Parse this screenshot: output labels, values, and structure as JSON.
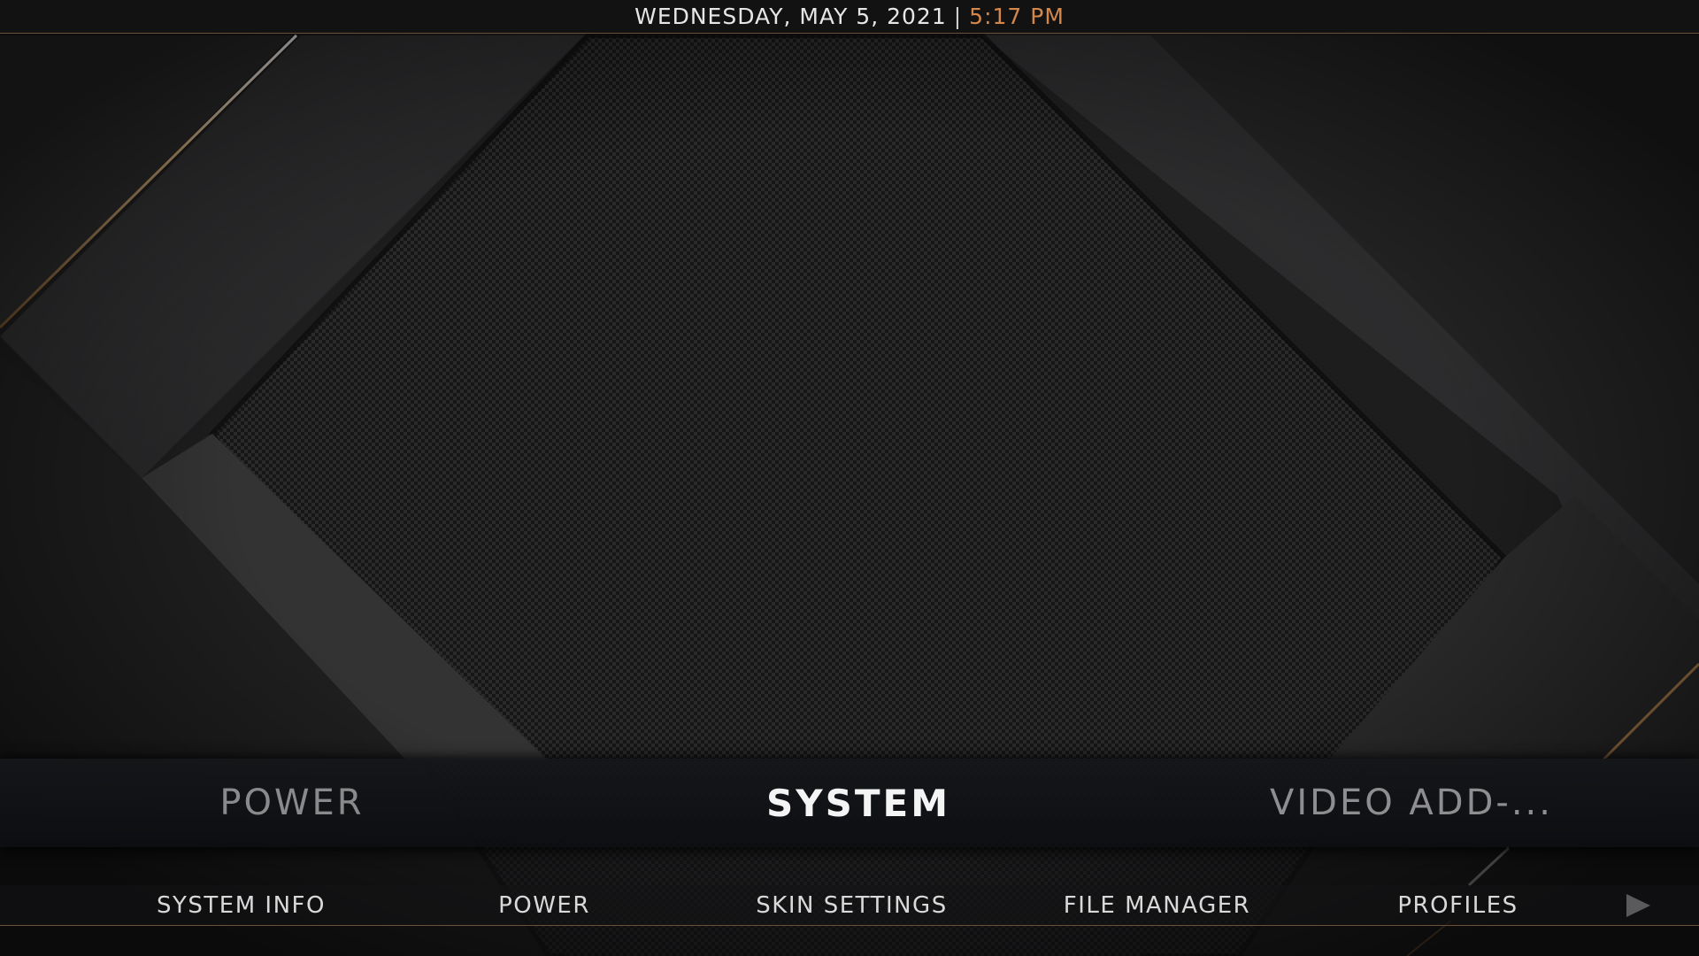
{
  "header": {
    "date": "WEDNESDAY, MAY 5, 2021",
    "separator": "|",
    "time": "5:17 PM"
  },
  "main_menu": {
    "previous": "POWER",
    "current": "SYSTEM",
    "next": "VIDEO ADD-..."
  },
  "submenu": {
    "items": [
      {
        "label": "SYSTEM INFO"
      },
      {
        "label": "POWER"
      },
      {
        "label": "SKIN SETTINGS"
      },
      {
        "label": "FILE MANAGER"
      },
      {
        "label": "PROFILES"
      }
    ],
    "next_icon": "play-arrow-icon"
  },
  "colors": {
    "accent": "#d4874a",
    "text_primary": "#f4f4f4",
    "text_muted": "#8a8a8c",
    "divider": "#6a5038",
    "background": "#1b1b1c"
  }
}
